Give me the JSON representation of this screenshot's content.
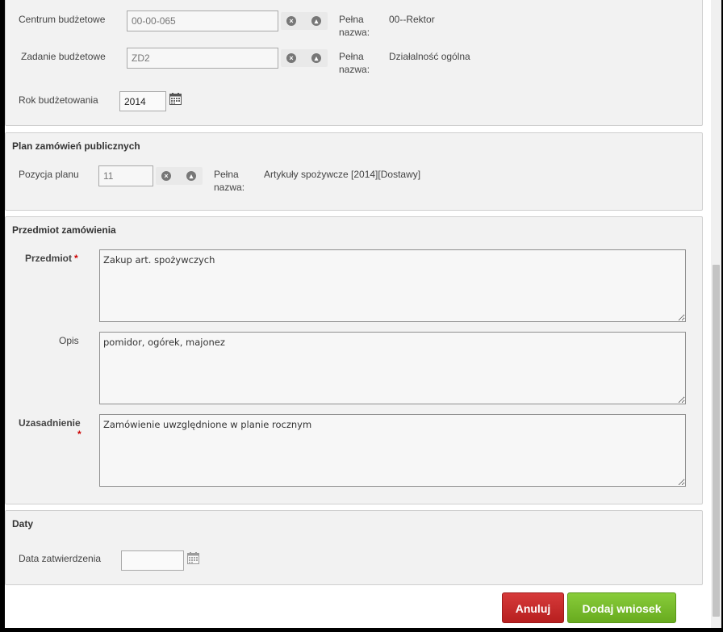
{
  "budget": {
    "center_label": "Centrum budżetowe",
    "center_value": "00-00-065",
    "full_name_label_1": "Pełna",
    "full_name_label_2": "nazwa:",
    "center_full_name": "00--Rektor",
    "task_label": "Zadanie budżetowe",
    "task_value": "ZD2",
    "task_full_name": "Działalność ogólna",
    "year_label": "Rok budżetowania",
    "year_value": "2014"
  },
  "plan": {
    "legend": "Plan zamówień publicznych",
    "position_label": "Pozycja planu",
    "position_value": "11",
    "full_name_label_1": "Pełna",
    "full_name_label_2": "nazwa:",
    "full_name": "Artykuły spożywcze [2014][Dostawy]"
  },
  "subject": {
    "legend": "Przedmiot zamówienia",
    "subject_label": "Przedmiot",
    "subject_value": "Zakup art. spożywczych",
    "description_label": "Opis",
    "description_value": "pomidor, ogórek, majonez",
    "justification_label": "Uzasadnienie",
    "justification_value": "Zamówienie uwzględnione w planie rocznym",
    "required_mark": "*"
  },
  "dates": {
    "legend": "Daty",
    "approval_label": "Data zatwierdzenia",
    "approval_value": ""
  },
  "actions": {
    "cancel_label": "Anuluj",
    "submit_label": "Dodaj wniosek"
  },
  "icons": {
    "clear": "clear-icon",
    "select": "select-icon",
    "calendar": "calendar-icon"
  }
}
